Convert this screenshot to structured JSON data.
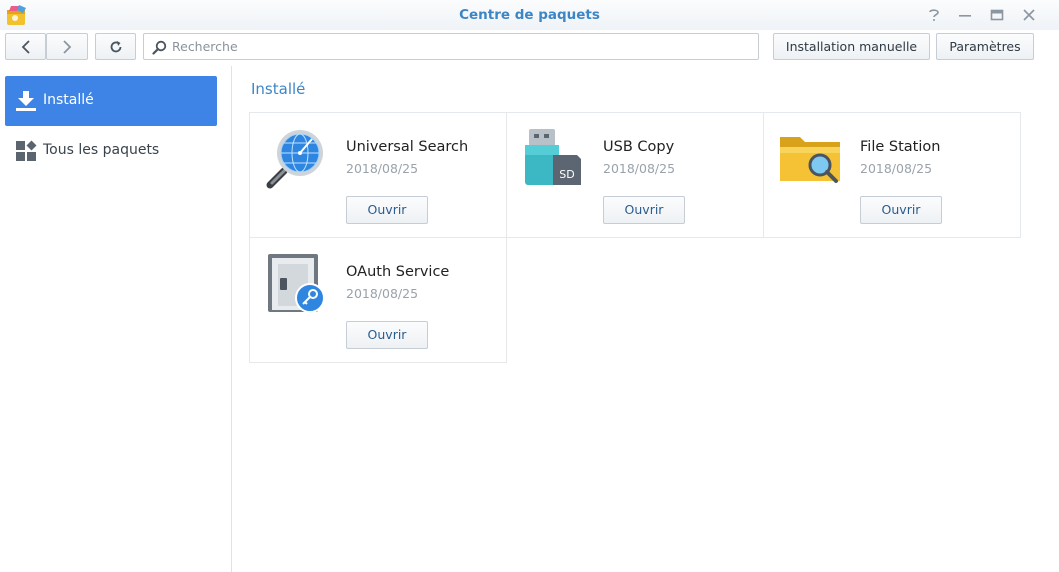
{
  "window": {
    "title": "Centre de paquets",
    "controls": {
      "help": "help-icon",
      "minimize": "minimize-icon",
      "maximize": "maximize-icon",
      "close": "close-icon"
    }
  },
  "toolbar": {
    "search_placeholder": "Recherche",
    "manual_install_label": "Installation manuelle",
    "settings_label": "Paramètres"
  },
  "sidebar": {
    "items": [
      {
        "label": "Installé",
        "icon": "download-icon",
        "active": true
      },
      {
        "label": "Tous les paquets",
        "icon": "grid-icon",
        "active": false
      }
    ]
  },
  "main": {
    "section_title": "Installé",
    "packages": [
      {
        "name": "Universal Search",
        "date": "2018/08/25",
        "icon": "magnifier-globe-icon",
        "button": "Ouvrir"
      },
      {
        "name": "USB Copy",
        "date": "2018/08/25",
        "icon": "usb-sd-icon",
        "button": "Ouvrir"
      },
      {
        "name": "File Station",
        "date": "2018/08/25",
        "icon": "folder-search-icon",
        "button": "Ouvrir"
      },
      {
        "name": "OAuth Service",
        "date": "2018/08/25",
        "icon": "key-door-icon",
        "button": "Ouvrir"
      }
    ]
  },
  "colors": {
    "accent": "#3d86c6",
    "active_nav": "#3e84e6",
    "border": "#c6cdd4"
  }
}
